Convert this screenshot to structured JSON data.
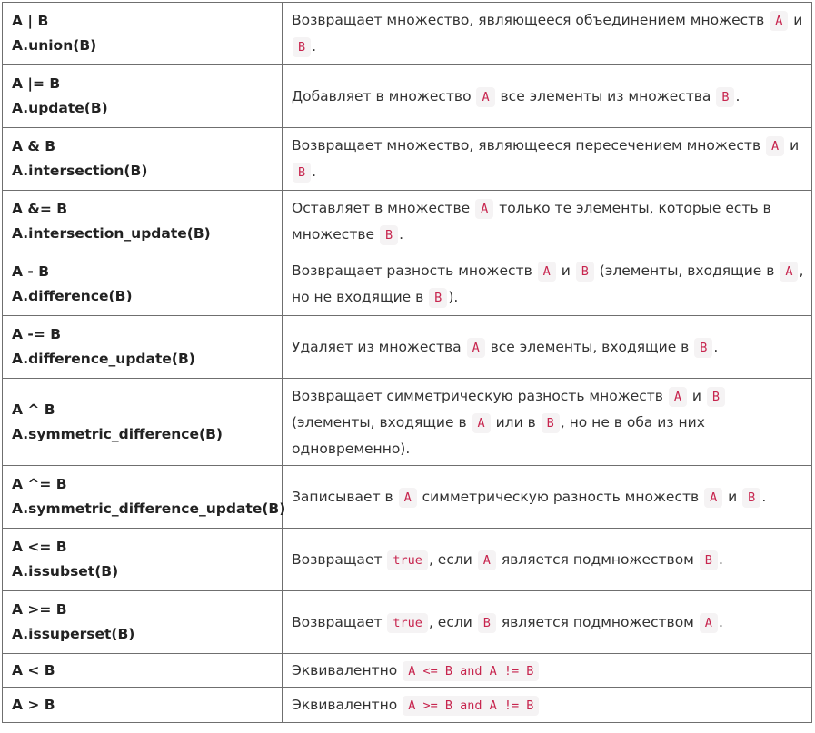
{
  "rows": [
    {
      "op": [
        "A | B",
        "A.union(B)"
      ],
      "desc": [
        [
          {
            "t": "Возвращает множество, являющееся объединением множеств "
          },
          {
            "c": "A"
          },
          {
            "t": " и"
          }
        ],
        [
          {
            "c": "B"
          },
          {
            "t": "."
          }
        ]
      ]
    },
    {
      "op": [
        "A |= B",
        "A.update(B)"
      ],
      "desc": [
        [
          {
            "t": "Добавляет в множество "
          },
          {
            "c": "A"
          },
          {
            "t": " все элементы из множества "
          },
          {
            "c": "B"
          },
          {
            "t": "."
          }
        ]
      ]
    },
    {
      "op": [
        "A & B",
        "A.intersection(B)"
      ],
      "desc": [
        [
          {
            "t": "Возвращает множество, являющееся пересечением множеств "
          },
          {
            "c": "A"
          },
          {
            "t": " и"
          }
        ],
        [
          {
            "c": "B"
          },
          {
            "t": "."
          }
        ]
      ]
    },
    {
      "op": [
        "A &= B",
        "A.intersection_update(B)"
      ],
      "desc": [
        [
          {
            "t": "Оставляет в множестве "
          },
          {
            "c": "A"
          },
          {
            "t": " только те элементы, которые есть в"
          }
        ],
        [
          {
            "t": "множестве "
          },
          {
            "c": "B"
          },
          {
            "t": "."
          }
        ]
      ]
    },
    {
      "op": [
        "A - B",
        "A.difference(B)"
      ],
      "desc": [
        [
          {
            "t": "Возвращает разность множеств "
          },
          {
            "c": "A"
          },
          {
            "t": " и "
          },
          {
            "c": "B"
          },
          {
            "t": " (элементы, входящие в "
          },
          {
            "c": "A"
          },
          {
            "t": ","
          }
        ],
        [
          {
            "t": "но не входящие в "
          },
          {
            "c": "B"
          },
          {
            "t": ")."
          }
        ]
      ]
    },
    {
      "op": [
        "A -= B",
        "A.difference_update(B)"
      ],
      "desc": [
        [
          {
            "t": "Удаляет из множества "
          },
          {
            "c": "A"
          },
          {
            "t": " все элементы, входящие в "
          },
          {
            "c": "B"
          },
          {
            "t": "."
          }
        ]
      ]
    },
    {
      "op": [
        "A ^ B",
        "A.symmetric_difference(B)"
      ],
      "desc": [
        [
          {
            "t": "Возвращает симметрическую разность множеств "
          },
          {
            "c": "A"
          },
          {
            "t": " и "
          },
          {
            "c": "B"
          }
        ],
        [
          {
            "t": "(элементы, входящие в "
          },
          {
            "c": "A"
          },
          {
            "t": " или в "
          },
          {
            "c": "B"
          },
          {
            "t": ", но не в оба из них"
          }
        ],
        [
          {
            "t": "одновременно)."
          }
        ]
      ]
    },
    {
      "op": [
        "A ^= B",
        "A.symmetric_difference_update(B)"
      ],
      "desc": [
        [
          {
            "t": "Записывает в "
          },
          {
            "c": "A"
          },
          {
            "t": " симметрическую разность множеств "
          },
          {
            "c": "A"
          },
          {
            "t": " и "
          },
          {
            "c": "B"
          },
          {
            "t": "."
          }
        ]
      ]
    },
    {
      "op": [
        "A <= B",
        "A.issubset(B)"
      ],
      "desc": [
        [
          {
            "t": "Возвращает "
          },
          {
            "c": "true"
          },
          {
            "t": ", если "
          },
          {
            "c": "A"
          },
          {
            "t": " является подмножеством "
          },
          {
            "c": "B"
          },
          {
            "t": "."
          }
        ]
      ]
    },
    {
      "op": [
        "A >= B",
        "A.issuperset(B)"
      ],
      "desc": [
        [
          {
            "t": "Возвращает "
          },
          {
            "c": "true"
          },
          {
            "t": ", если "
          },
          {
            "c": "B"
          },
          {
            "t": " является подмножеством "
          },
          {
            "c": "A"
          },
          {
            "t": "."
          }
        ]
      ]
    },
    {
      "op": [
        "A < B"
      ],
      "desc": [
        [
          {
            "t": "Эквивалентно "
          },
          {
            "c": "A <= B and A != B"
          }
        ]
      ]
    },
    {
      "op": [
        "A > B"
      ],
      "desc": [
        [
          {
            "t": "Эквивалентно "
          },
          {
            "c": "A >= B and A != B"
          }
        ]
      ]
    }
  ],
  "colors": {
    "code_text": "#c7254e",
    "code_bg": "#f5f3f4",
    "border": "#6f6f6f",
    "text": "#333333"
  }
}
